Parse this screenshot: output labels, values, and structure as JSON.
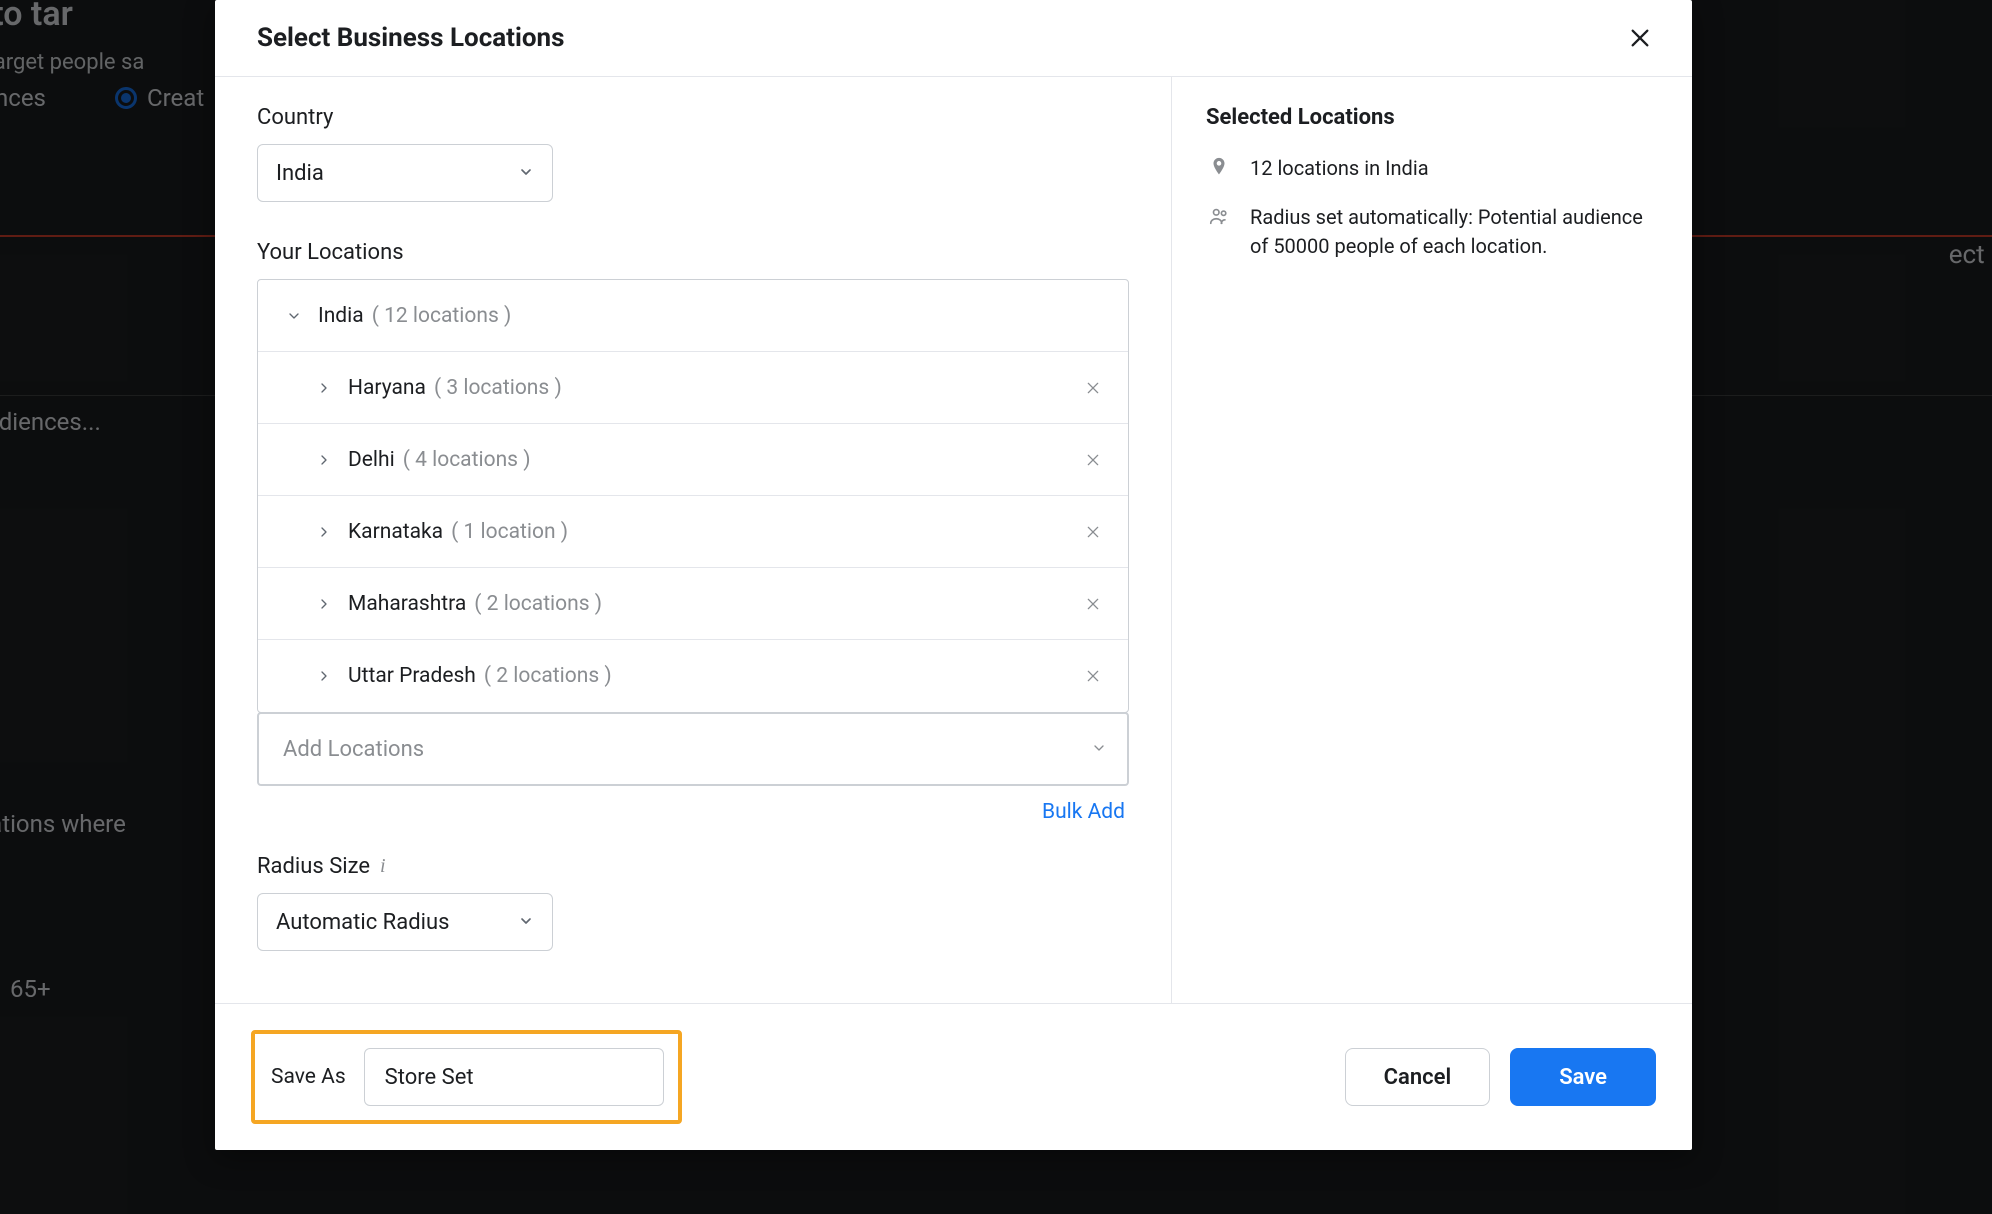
{
  "background": {
    "heading_fragment": "want to tar",
    "subtext_fragment": "lly target people sa",
    "radio_fragment_left": "nces",
    "radio_label_fragment": "Creat",
    "error_fragment": "ect at least on",
    "audiences_fragment": "Audiences...",
    "locations_fragment": "Locations where",
    "age_fragment": "65+"
  },
  "modal": {
    "title": "Select Business Locations",
    "country_label": "Country",
    "country_value": "India",
    "your_locations_label": "Your Locations",
    "tree_root": {
      "name": "India",
      "count_text": "( 12 locations )"
    },
    "tree_children": [
      {
        "name": "Haryana",
        "count_text": "( 3 locations )"
      },
      {
        "name": "Delhi",
        "count_text": "( 4 locations )"
      },
      {
        "name": "Karnataka",
        "count_text": "( 1 location )"
      },
      {
        "name": "Maharashtra",
        "count_text": "( 2 locations )"
      },
      {
        "name": "Uttar Pradesh",
        "count_text": "( 2 locations )"
      }
    ],
    "add_locations_placeholder": "Add Locations",
    "bulk_add_label": "Bulk Add",
    "radius_label": "Radius Size",
    "radius_value": "Automatic Radius",
    "summary": {
      "title": "Selected Locations",
      "line1": "12 locations in India",
      "line2": "Radius set automatically: Potential audience of 50000 people of each location."
    },
    "footer": {
      "save_as_label": "Save As",
      "save_as_value": "Store Set",
      "cancel_label": "Cancel",
      "save_label": "Save"
    }
  }
}
